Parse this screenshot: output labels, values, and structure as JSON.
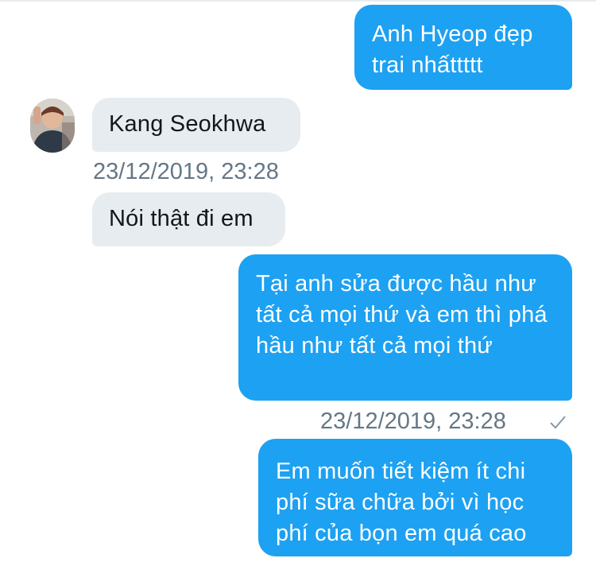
{
  "messages": [
    {
      "side": "sent",
      "text": "Anh Hyeop đẹp trai nhấttttt"
    },
    {
      "side": "received",
      "text": "Kang Seokhwa"
    },
    {
      "side": "received",
      "text": "Nói thật đi em"
    },
    {
      "side": "sent",
      "text": "Tại anh sửa được hầu như tất cả mọi thứ và em thì phá hầu như tất cả mọi thứ"
    },
    {
      "side": "sent",
      "text": "Em muốn tiết kiệm ít chi phí sữa chữa bởi vì học phí của bọn em quá cao"
    }
  ],
  "timestamps": {
    "received": "23/12/2019, 23:28",
    "sent": "23/12/2019, 23:28"
  },
  "colors": {
    "sent_bubble": "#1da1f2",
    "received_bubble": "#e6ecf0",
    "timestamp_text": "#657786",
    "background": "#ffffff"
  },
  "icons": {
    "sent_status": "check-icon",
    "contact_avatar": "avatar"
  }
}
